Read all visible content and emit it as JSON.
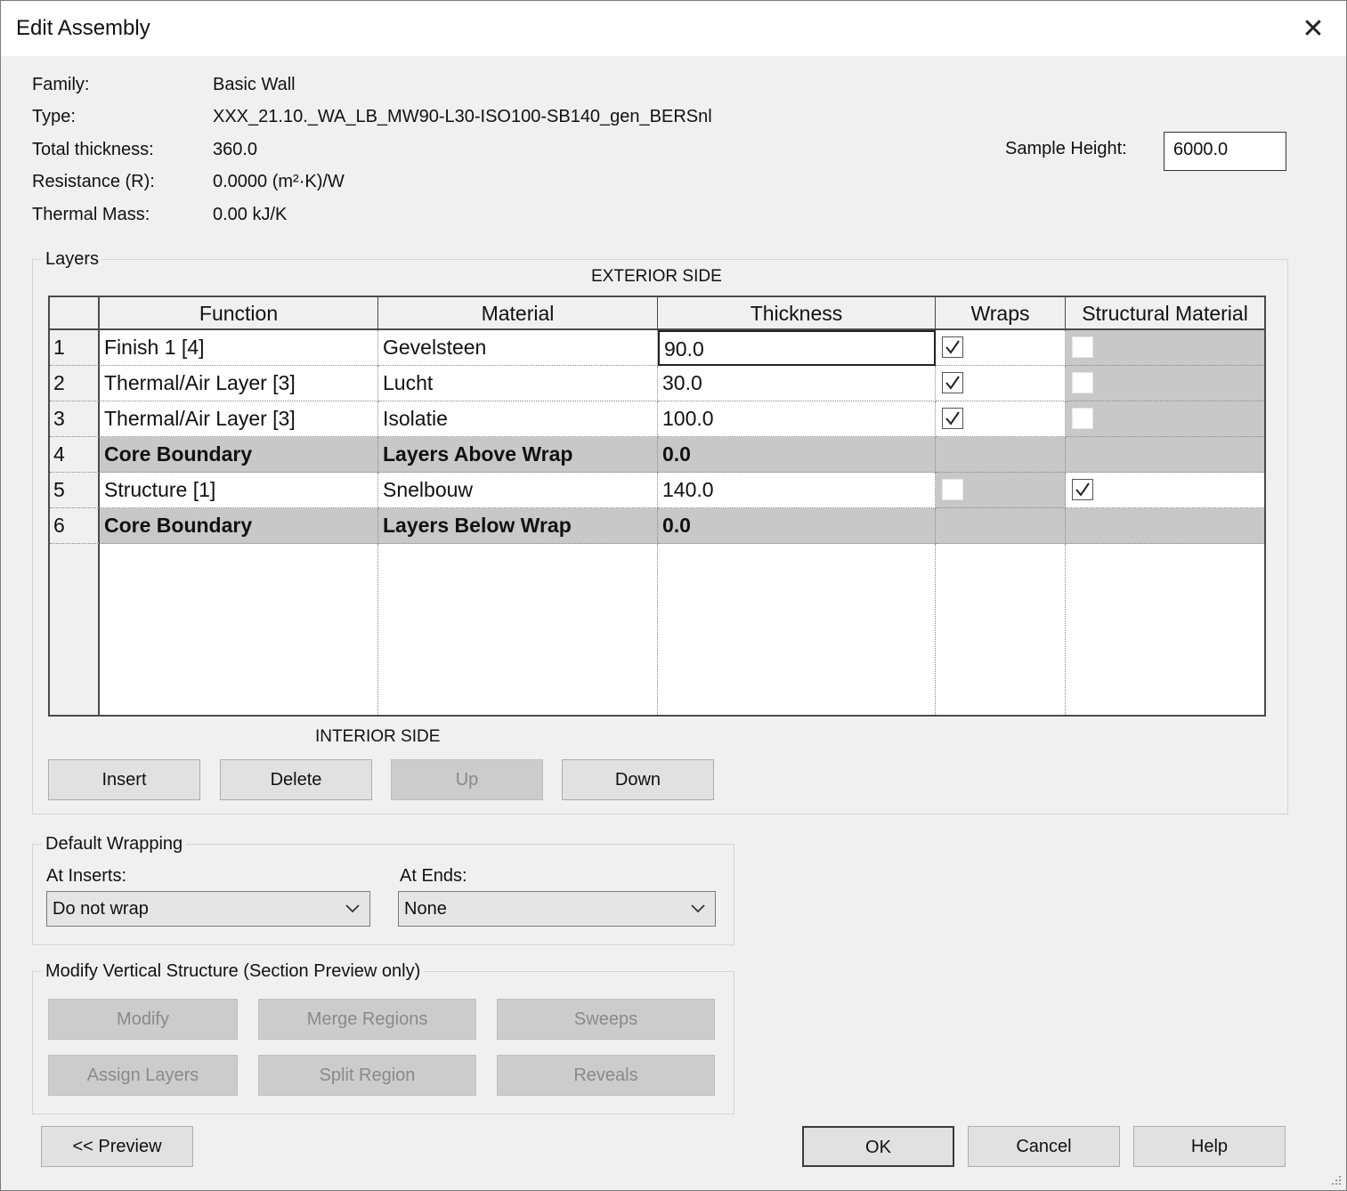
{
  "window": {
    "title": "Edit Assembly",
    "close_glyph": "✕"
  },
  "info": {
    "family_label": "Family:",
    "family_value": "Basic Wall",
    "type_label": "Type:",
    "type_value": "XXX_21.10._WA_LB_MW90-L30-ISO100-SB140_gen_BERSnl",
    "thickness_label": "Total thickness:",
    "thickness_value": "360.0",
    "resistance_label": "Resistance (R):",
    "resistance_value": "0.0000 (m²·K)/W",
    "mass_label": "Thermal Mass:",
    "mass_value": "0.00 kJ/K",
    "sample_height_label": "Sample Height:",
    "sample_height_value": "6000.0"
  },
  "layers": {
    "group_label": "Layers",
    "exterior_label": "EXTERIOR SIDE",
    "interior_label": "INTERIOR SIDE",
    "columns": [
      "Function",
      "Material",
      "Thickness",
      "Wraps",
      "Structural Material"
    ],
    "rows": [
      {
        "num": "1",
        "function": "Finish 1 [4]",
        "material": "Gevelsteen",
        "thickness": "90.0"
      },
      {
        "num": "2",
        "function": "Thermal/Air Layer [3]",
        "material": "Lucht",
        "thickness": "30.0"
      },
      {
        "num": "3",
        "function": "Thermal/Air Layer [3]",
        "material": "Isolatie",
        "thickness": "100.0"
      },
      {
        "num": "4",
        "function": "Core Boundary",
        "material": "Layers Above Wrap",
        "thickness": "0.0"
      },
      {
        "num": "5",
        "function": "Structure [1]",
        "material": "Snelbouw",
        "thickness": "140.0"
      },
      {
        "num": "6",
        "function": "Core Boundary",
        "material": "Layers Below Wrap",
        "thickness": "0.0"
      }
    ],
    "buttons": {
      "insert": "Insert",
      "delete": "Delete",
      "up": "Up",
      "down": "Down"
    }
  },
  "wrapping": {
    "group_label": "Default Wrapping",
    "inserts_label": "At Inserts:",
    "inserts_value": "Do not wrap",
    "ends_label": "At  Ends:",
    "ends_value": "None"
  },
  "vertical": {
    "group_label": "Modify Vertical Structure (Section Preview only)",
    "modify": "Modify",
    "merge": "Merge Regions",
    "sweeps": "Sweeps",
    "assign": "Assign Layers",
    "split": "Split Region",
    "reveals": "Reveals"
  },
  "footer": {
    "preview": "<< Preview",
    "ok": "OK",
    "cancel": "Cancel",
    "help": "Help"
  },
  "icons": {
    "close": "close-icon",
    "checkbox": "checkmark-icon",
    "dropdown": "chevron-down-icon",
    "grip": "resize-grip-icon"
  }
}
